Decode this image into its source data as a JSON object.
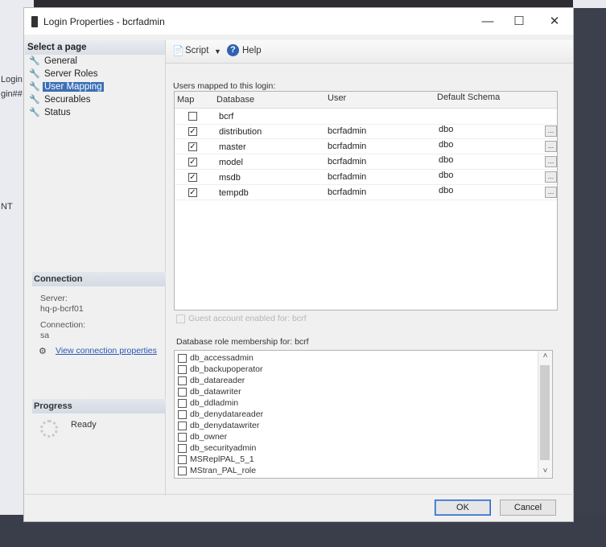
{
  "background_fragments": [
    "Login",
    "gin##",
    "NT"
  ],
  "window": {
    "title": "Login Properties - bcrfadmin",
    "controls": {
      "minimize": "—",
      "maximize": "☐",
      "close": "✕"
    }
  },
  "left_pane": {
    "header": "Select a page",
    "pages": [
      {
        "label": "General",
        "selected": false
      },
      {
        "label": "Server Roles",
        "selected": false
      },
      {
        "label": "User Mapping",
        "selected": true
      },
      {
        "label": "Securables",
        "selected": false
      },
      {
        "label": "Status",
        "selected": false
      }
    ]
  },
  "connection": {
    "header": "Connection",
    "server_label": "Server:",
    "server_value": "hq-p-bcrf01",
    "connection_label": "Connection:",
    "connection_value": "sa",
    "view_link": "View connection properties"
  },
  "progress": {
    "header": "Progress",
    "status": "Ready"
  },
  "toolbar": {
    "script": "Script",
    "help": "Help"
  },
  "users_mapped": {
    "label": "Users mapped to this login:",
    "columns": [
      "Map",
      "Database",
      "User",
      "Default Schema"
    ],
    "rows": [
      {
        "map": false,
        "database": "bcrf",
        "user": "",
        "schema": ""
      },
      {
        "map": true,
        "database": "distribution",
        "user": "bcrfadmin",
        "schema": "dbo"
      },
      {
        "map": true,
        "database": "master",
        "user": "bcrfadmin",
        "schema": "dbo"
      },
      {
        "map": true,
        "database": "model",
        "user": "bcrfadmin",
        "schema": "dbo"
      },
      {
        "map": true,
        "database": "msdb",
        "user": "bcrfadmin",
        "schema": "dbo"
      },
      {
        "map": true,
        "database": "tempdb",
        "user": "bcrfadmin",
        "schema": "dbo"
      }
    ],
    "ellipsis": "..."
  },
  "guest": {
    "label": "Guest account enabled for: bcrf",
    "enabled": false
  },
  "roles": {
    "label": "Database role membership for: bcrf",
    "items": [
      "db_accessadmin",
      "db_backupoperator",
      "db_datareader",
      "db_datawriter",
      "db_ddladmin",
      "db_denydatareader",
      "db_denydatawriter",
      "db_owner",
      "db_securityadmin",
      "MSReplPAL_5_1",
      "MStran_PAL_role"
    ]
  },
  "buttons": {
    "ok": "OK",
    "cancel": "Cancel"
  }
}
